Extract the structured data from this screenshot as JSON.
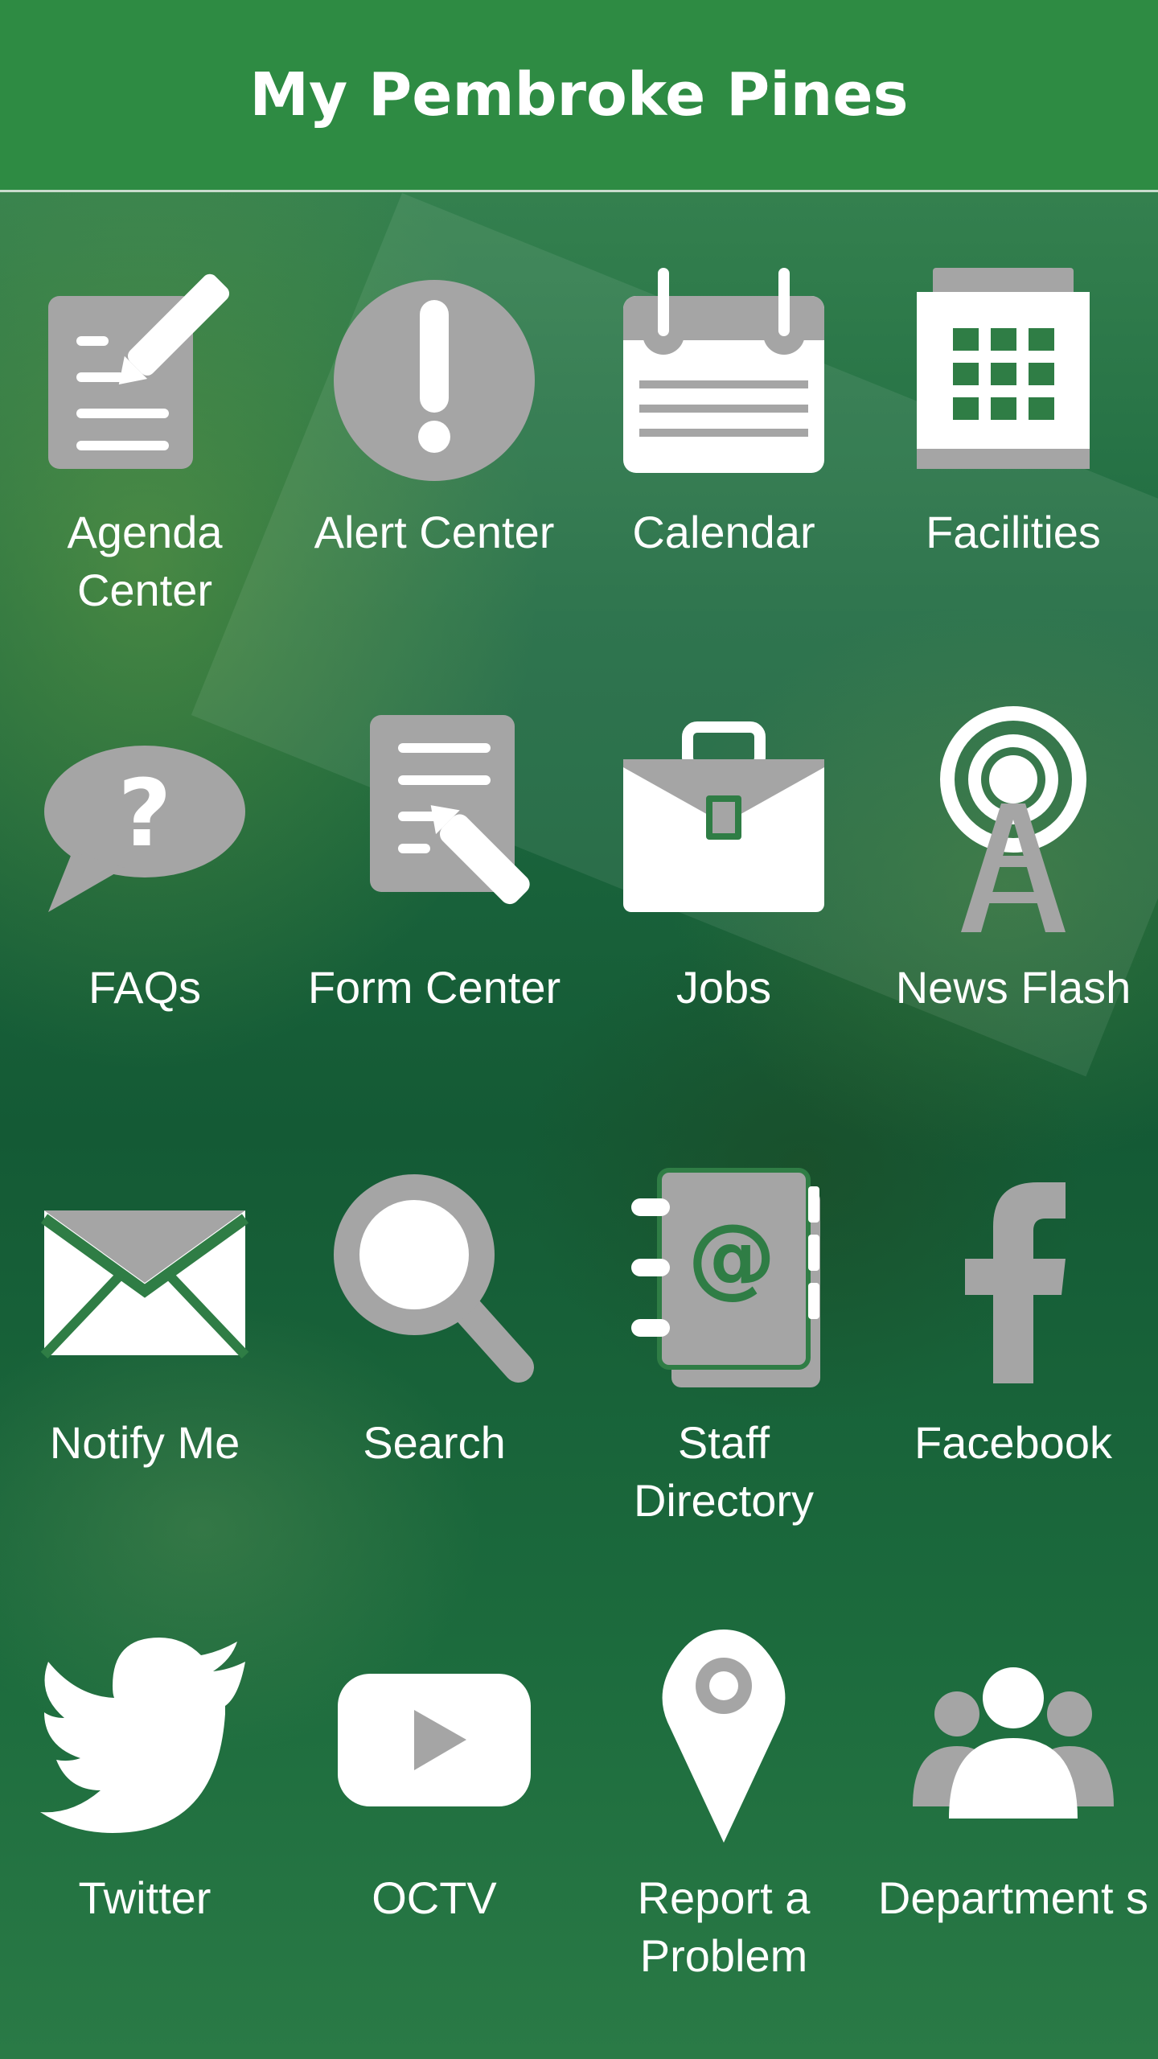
{
  "header": {
    "title": "My Pembroke Pines"
  },
  "tiles": [
    {
      "label": "Agenda Center",
      "icon": "agenda-icon"
    },
    {
      "label": "Alert Center",
      "icon": "alert-icon"
    },
    {
      "label": "Calendar",
      "icon": "calendar-icon"
    },
    {
      "label": "Facilities",
      "icon": "facilities-icon"
    },
    {
      "label": "FAQs",
      "icon": "faq-icon"
    },
    {
      "label": "Form Center",
      "icon": "form-icon"
    },
    {
      "label": "Jobs",
      "icon": "briefcase-icon"
    },
    {
      "label": "News Flash",
      "icon": "broadcast-tower-icon"
    },
    {
      "label": "Notify Me",
      "icon": "envelope-icon"
    },
    {
      "label": "Search",
      "icon": "search-icon"
    },
    {
      "label": "Staff Directory",
      "icon": "address-book-icon"
    },
    {
      "label": "Facebook",
      "icon": "facebook-icon"
    },
    {
      "label": "Twitter",
      "icon": "twitter-icon"
    },
    {
      "label": "OCTV",
      "icon": "youtube-icon"
    },
    {
      "label": "Report a Problem",
      "icon": "map-pin-icon"
    },
    {
      "label": "Department s",
      "icon": "people-icon"
    }
  ],
  "colors": {
    "header_bg": "#2e8b43",
    "icon_gray": "#a5a5a5",
    "icon_white": "#ffffff",
    "label_text": "#ffffff"
  }
}
